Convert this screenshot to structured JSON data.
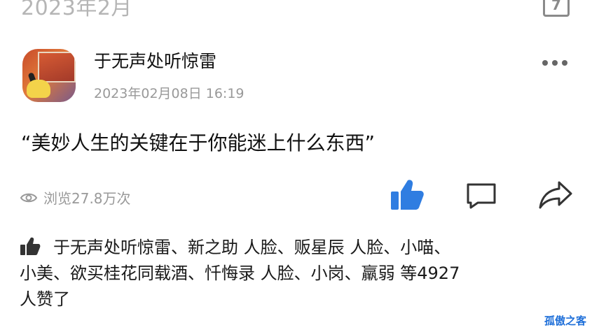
{
  "header": {
    "month": "2023年2月",
    "calendar_day": "7"
  },
  "post": {
    "username": "于无声处听惊雷",
    "time": "2023年02月08日 16:19",
    "text": "“美妙人生的关键在于你能迷上什么东西”",
    "views": "浏览27.8万次"
  },
  "likes": {
    "line1": "于无声处听惊雷、新之助  人脸、贩星辰 人脸、小喵、",
    "line2": "小美、欲买桂花同载酒、忏悔录 人脸、小岗、羸弱 等4927",
    "line3": "人赞了"
  },
  "watermark": "孤傲之客",
  "icons": [
    "calendar-icon",
    "more-icon",
    "eye-icon",
    "like-icon",
    "comment-icon",
    "share-icon",
    "thumb-icon"
  ],
  "colors": {
    "accent": "#2f7de1",
    "muted": "#999999"
  }
}
